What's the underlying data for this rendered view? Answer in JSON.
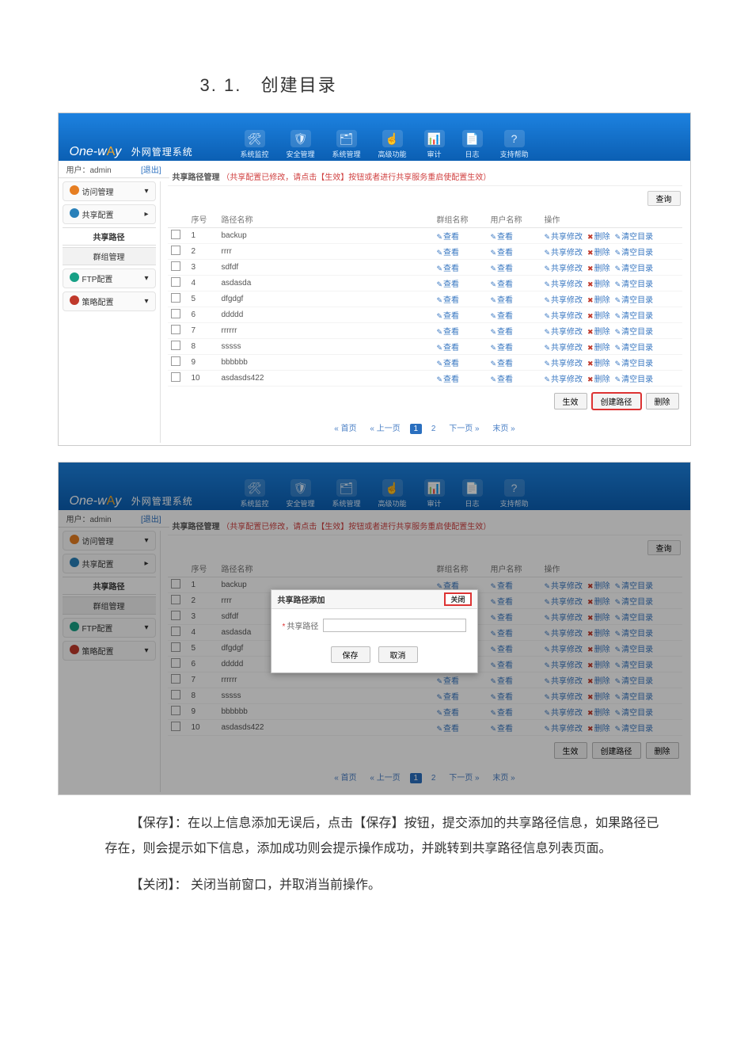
{
  "doc": {
    "section_number": "3. 1.",
    "section_title": "创建目录",
    "para1": "【保存】：在以上信息添加无误后，点击【保存】按钮，提交添加的共享路径信息，如果路径已存在，则会提示如下信息，添加成功则会提示操作成功，并跳转到共享路径信息列表页面。",
    "para2": "【关闭】： 关闭当前窗口，并取消当前操作。"
  },
  "app": {
    "product_name_prefix": "One-w",
    "product_name_accent": "A",
    "product_name_suffix": "y",
    "product_subtitle": "外网管理系统",
    "user_label": "用户：",
    "user_name": "admin",
    "logout": "[退出]",
    "top_nav": [
      {
        "icon": "🛠",
        "label": "系统监控"
      },
      {
        "icon": "🛡",
        "label": "安全管理"
      },
      {
        "icon": "🗂",
        "label": "系统管理"
      },
      {
        "icon": "☝",
        "label": "高级功能"
      },
      {
        "icon": "📊",
        "label": "审计"
      },
      {
        "icon": "📄",
        "label": "日志"
      },
      {
        "icon": "?",
        "label": "支持帮助"
      }
    ],
    "sidebar": {
      "items": [
        {
          "icon_color": "#e67e22",
          "label": "访问管理",
          "expand": "▾"
        },
        {
          "icon_color": "#2980b9",
          "label": "共享配置",
          "expand": "▸"
        }
      ],
      "subs": [
        {
          "label": "共享路径",
          "active": true
        },
        {
          "label": "群组管理",
          "active": false
        }
      ],
      "items2": [
        {
          "icon_color": "#16a085",
          "label": "FTP配置",
          "expand": "▾"
        },
        {
          "icon_color": "#c0392b",
          "label": "策略配置",
          "expand": "▾"
        }
      ]
    },
    "page_heading": "共享路径管理",
    "page_warning": "（共享配置已修改，请点击【生效】按钮或者进行共享服务重启使配置生效）",
    "search_btn": "查询",
    "columns": {
      "check": "",
      "seq": "序号",
      "pathname": "路径名称",
      "group": "群组名称",
      "user": "用户名称",
      "ops": "操作"
    },
    "row_view": "查看",
    "row_ops": {
      "modify": "共享修改",
      "delete": "删除",
      "clear": "清空目录"
    },
    "rows": [
      {
        "seq": "1",
        "pathname": "backup"
      },
      {
        "seq": "2",
        "pathname": "rrrr"
      },
      {
        "seq": "3",
        "pathname": "sdfdf"
      },
      {
        "seq": "4",
        "pathname": "asdasda"
      },
      {
        "seq": "5",
        "pathname": "dfgdgf"
      },
      {
        "seq": "6",
        "pathname": "ddddd"
      },
      {
        "seq": "7",
        "pathname": "rrrrrr"
      },
      {
        "seq": "8",
        "pathname": "sssss"
      },
      {
        "seq": "9",
        "pathname": "bbbbbb"
      },
      {
        "seq": "10",
        "pathname": "asdasds422"
      }
    ],
    "table_actions": {
      "apply": "生效",
      "create": "创建路径",
      "delete": "删除"
    },
    "pager": {
      "first": "« 首页",
      "prev": "« 上一页",
      "p1": "1",
      "p2": "2",
      "next": "下一页 »",
      "last": "末页 »"
    },
    "modal": {
      "title": "共享路径添加",
      "close": "关闭",
      "field_label": "共享路径",
      "field_value": "",
      "save": "保存",
      "cancel": "取消"
    }
  }
}
